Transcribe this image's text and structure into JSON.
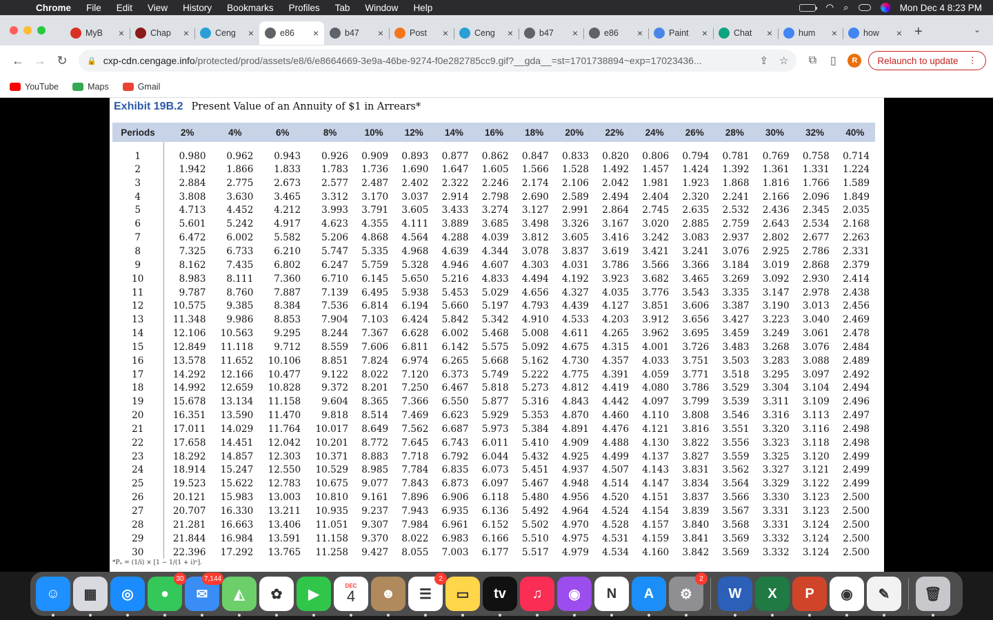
{
  "menubar": {
    "app": "Chrome",
    "items": [
      "File",
      "Edit",
      "View",
      "History",
      "Bookmarks",
      "Profiles",
      "Tab",
      "Window",
      "Help"
    ],
    "clock": "Mon Dec 4  8:23 PM"
  },
  "tabs": [
    {
      "label": "MyB",
      "icon": "bar-chart-icon",
      "color": "#d93025"
    },
    {
      "label": "Chap",
      "icon": "chapter-icon",
      "color": "#8b1a1a"
    },
    {
      "label": "Ceng",
      "icon": "cengage-icon",
      "color": "#2a9fd6"
    },
    {
      "label": "e86",
      "icon": "globe-icon",
      "color": "#5f6368"
    },
    {
      "label": "b47",
      "icon": "globe-icon",
      "color": "#5f6368"
    },
    {
      "label": "Post",
      "icon": "post-icon",
      "color": "#f5761a"
    },
    {
      "label": "Ceng",
      "icon": "cengage-icon",
      "color": "#2a9fd6"
    },
    {
      "label": "b47",
      "icon": "globe-icon",
      "color": "#5f6368"
    },
    {
      "label": "e86",
      "icon": "globe-icon",
      "color": "#5f6368"
    },
    {
      "label": "Paint",
      "icon": "paint-icon",
      "color": "#4a86e8"
    },
    {
      "label": "Chat",
      "icon": "chat-icon",
      "color": "#10a37f"
    },
    {
      "label": "hum",
      "icon": "google-icon",
      "color": "#4285f4"
    },
    {
      "label": "how",
      "icon": "google-icon",
      "color": "#4285f4"
    }
  ],
  "active_tab_index": 3,
  "address": {
    "host": "cxp-cdn.cengage.info",
    "path": "/protected/prod/assets/e8/6/e8664669-3e9a-46be-9274-f0e282785cc9.gif?__gda__=st=1701738894~exp=17023436..."
  },
  "profile_initial": "R",
  "relaunch_label": "Relaunch to update",
  "bookmarks": [
    {
      "label": "YouTube",
      "color": "#ff0000"
    },
    {
      "label": "Maps",
      "color": "#34a853"
    },
    {
      "label": "Gmail",
      "color": "#ea4335"
    }
  ],
  "exhibit": {
    "number": "Exhibit 19B.2",
    "title": "Present Value of an Annuity of $1 in Arrears*",
    "footnote": "*Pₙ = (1/i) × [1 − 1/(1 + i)ⁿ]."
  },
  "table": {
    "headers": [
      "Periods",
      "2%",
      "4%",
      "6%",
      "8%",
      "10%",
      "12%",
      "14%",
      "16%",
      "18%",
      "20%",
      "22%",
      "24%",
      "26%",
      "28%",
      "30%",
      "32%",
      "40%"
    ],
    "rows": [
      [
        "1",
        "0.980",
        "0.962",
        "0.943",
        "0.926",
        "0.909",
        "0.893",
        "0.877",
        "0.862",
        "0.847",
        "0.833",
        "0.820",
        "0.806",
        "0.794",
        "0.781",
        "0.769",
        "0.758",
        "0.714"
      ],
      [
        "2",
        "1.942",
        "1.866",
        "1.833",
        "1.783",
        "1.736",
        "1.690",
        "1.647",
        "1.605",
        "1.566",
        "1.528",
        "1.492",
        "1.457",
        "1.424",
        "1.392",
        "1.361",
        "1.331",
        "1.224"
      ],
      [
        "3",
        "2.884",
        "2.775",
        "2.673",
        "2.577",
        "2.487",
        "2.402",
        "2.322",
        "2.246",
        "2.174",
        "2.106",
        "2.042",
        "1.981",
        "1.923",
        "1.868",
        "1.816",
        "1.766",
        "1.589"
      ],
      [
        "4",
        "3.808",
        "3.630",
        "3.465",
        "3.312",
        "3.170",
        "3.037",
        "2.914",
        "2.798",
        "2.690",
        "2.589",
        "2.494",
        "2.404",
        "2.320",
        "2.241",
        "2.166",
        "2.096",
        "1.849"
      ],
      [
        "5",
        "4.713",
        "4.452",
        "4.212",
        "3.993",
        "3.791",
        "3.605",
        "3.433",
        "3.274",
        "3.127",
        "2.991",
        "2.864",
        "2.745",
        "2.635",
        "2.532",
        "2.436",
        "2.345",
        "2.035"
      ],
      [
        "6",
        "5.601",
        "5.242",
        "4.917",
        "4.623",
        "4.355",
        "4.111",
        "3.889",
        "3.685",
        "3.498",
        "3.326",
        "3.167",
        "3.020",
        "2.885",
        "2.759",
        "2.643",
        "2.534",
        "2.168"
      ],
      [
        "7",
        "6.472",
        "6.002",
        "5.582",
        "5.206",
        "4.868",
        "4.564",
        "4.288",
        "4.039",
        "3.812",
        "3.605",
        "3.416",
        "3.242",
        "3.083",
        "2.937",
        "2.802",
        "2.677",
        "2.263"
      ],
      [
        "8",
        "7.325",
        "6.733",
        "6.210",
        "5.747",
        "5.335",
        "4.968",
        "4.639",
        "4.344",
        "3.078",
        "3.837",
        "3.619",
        "3.421",
        "3.241",
        "3.076",
        "2.925",
        "2.786",
        "2.331"
      ],
      [
        "9",
        "8.162",
        "7.435",
        "6.802",
        "6.247",
        "5.759",
        "5.328",
        "4.946",
        "4.607",
        "4.303",
        "4.031",
        "3.786",
        "3.566",
        "3.366",
        "3.184",
        "3.019",
        "2.868",
        "2.379"
      ],
      [
        "10",
        "8.983",
        "8.111",
        "7.360",
        "6.710",
        "6.145",
        "5.650",
        "5.216",
        "4.833",
        "4.494",
        "4.192",
        "3.923",
        "3.682",
        "3.465",
        "3.269",
        "3.092",
        "2.930",
        "2.414"
      ],
      [
        "11",
        "9.787",
        "8.760",
        "7.887",
        "7.139",
        "6.495",
        "5.938",
        "5.453",
        "5.029",
        "4.656",
        "4.327",
        "4.035",
        "3.776",
        "3.543",
        "3.335",
        "3.147",
        "2.978",
        "2.438"
      ],
      [
        "12",
        "10.575",
        "9.385",
        "8.384",
        "7.536",
        "6.814",
        "6.194",
        "5.660",
        "5.197",
        "4.793",
        "4.439",
        "4.127",
        "3.851",
        "3.606",
        "3.387",
        "3.190",
        "3.013",
        "2.456"
      ],
      [
        "13",
        "11.348",
        "9.986",
        "8.853",
        "7.904",
        "7.103",
        "6.424",
        "5.842",
        "5.342",
        "4.910",
        "4.533",
        "4.203",
        "3.912",
        "3.656",
        "3.427",
        "3.223",
        "3.040",
        "2.469"
      ],
      [
        "14",
        "12.106",
        "10.563",
        "9.295",
        "8.244",
        "7.367",
        "6.628",
        "6.002",
        "5.468",
        "5.008",
        "4.611",
        "4.265",
        "3.962",
        "3.695",
        "3.459",
        "3.249",
        "3.061",
        "2.478"
      ],
      [
        "15",
        "12.849",
        "11.118",
        "9.712",
        "8.559",
        "7.606",
        "6.811",
        "6.142",
        "5.575",
        "5.092",
        "4.675",
        "4.315",
        "4.001",
        "3.726",
        "3.483",
        "3.268",
        "3.076",
        "2.484"
      ],
      [
        "16",
        "13.578",
        "11.652",
        "10.106",
        "8.851",
        "7.824",
        "6.974",
        "6.265",
        "5.668",
        "5.162",
        "4.730",
        "4.357",
        "4.033",
        "3.751",
        "3.503",
        "3.283",
        "3.088",
        "2.489"
      ],
      [
        "17",
        "14.292",
        "12.166",
        "10.477",
        "9.122",
        "8.022",
        "7.120",
        "6.373",
        "5.749",
        "5.222",
        "4.775",
        "4.391",
        "4.059",
        "3.771",
        "3.518",
        "3.295",
        "3.097",
        "2.492"
      ],
      [
        "18",
        "14.992",
        "12.659",
        "10.828",
        "9.372",
        "8.201",
        "7.250",
        "6.467",
        "5.818",
        "5.273",
        "4.812",
        "4.419",
        "4.080",
        "3.786",
        "3.529",
        "3.304",
        "3.104",
        "2.494"
      ],
      [
        "19",
        "15.678",
        "13.134",
        "11.158",
        "9.604",
        "8.365",
        "7.366",
        "6.550",
        "5.877",
        "5.316",
        "4.843",
        "4.442",
        "4.097",
        "3.799",
        "3.539",
        "3.311",
        "3.109",
        "2.496"
      ],
      [
        "20",
        "16.351",
        "13.590",
        "11.470",
        "9.818",
        "8.514",
        "7.469",
        "6.623",
        "5.929",
        "5.353",
        "4.870",
        "4.460",
        "4.110",
        "3.808",
        "3.546",
        "3.316",
        "3.113",
        "2.497"
      ],
      [
        "21",
        "17.011",
        "14.029",
        "11.764",
        "10.017",
        "8.649",
        "7.562",
        "6.687",
        "5.973",
        "5.384",
        "4.891",
        "4.476",
        "4.121",
        "3.816",
        "3.551",
        "3.320",
        "3.116",
        "2.498"
      ],
      [
        "22",
        "17.658",
        "14.451",
        "12.042",
        "10.201",
        "8.772",
        "7.645",
        "6.743",
        "6.011",
        "5.410",
        "4.909",
        "4.488",
        "4.130",
        "3.822",
        "3.556",
        "3.323",
        "3.118",
        "2.498"
      ],
      [
        "23",
        "18.292",
        "14.857",
        "12.303",
        "10.371",
        "8.883",
        "7.718",
        "6.792",
        "6.044",
        "5.432",
        "4.925",
        "4.499",
        "4.137",
        "3.827",
        "3.559",
        "3.325",
        "3.120",
        "2.499"
      ],
      [
        "24",
        "18.914",
        "15.247",
        "12.550",
        "10.529",
        "8.985",
        "7.784",
        "6.835",
        "6.073",
        "5.451",
        "4.937",
        "4.507",
        "4.143",
        "3.831",
        "3.562",
        "3.327",
        "3.121",
        "2.499"
      ],
      [
        "25",
        "19.523",
        "15.622",
        "12.783",
        "10.675",
        "9.077",
        "7.843",
        "6.873",
        "6.097",
        "5.467",
        "4.948",
        "4.514",
        "4.147",
        "3.834",
        "3.564",
        "3.329",
        "3.122",
        "2.499"
      ],
      [
        "26",
        "20.121",
        "15.983",
        "13.003",
        "10.810",
        "9.161",
        "7.896",
        "6.906",
        "6.118",
        "5.480",
        "4.956",
        "4.520",
        "4.151",
        "3.837",
        "3.566",
        "3.330",
        "3.123",
        "2.500"
      ],
      [
        "27",
        "20.707",
        "16.330",
        "13.211",
        "10.935",
        "9.237",
        "7.943",
        "6.935",
        "6.136",
        "5.492",
        "4.964",
        "4.524",
        "4.154",
        "3.839",
        "3.567",
        "3.331",
        "3.123",
        "2.500"
      ],
      [
        "28",
        "21.281",
        "16.663",
        "13.406",
        "11.051",
        "9.307",
        "7.984",
        "6.961",
        "6.152",
        "5.502",
        "4.970",
        "4.528",
        "4.157",
        "3.840",
        "3.568",
        "3.331",
        "3.124",
        "2.500"
      ],
      [
        "29",
        "21.844",
        "16.984",
        "13.591",
        "11.158",
        "9.370",
        "8.022",
        "6.983",
        "6.166",
        "5.510",
        "4.975",
        "4.531",
        "4.159",
        "3.841",
        "3.569",
        "3.332",
        "3.124",
        "2.500"
      ],
      [
        "30",
        "22.396",
        "17.292",
        "13.765",
        "11.258",
        "9.427",
        "8.055",
        "7.003",
        "6.177",
        "5.517",
        "4.979",
        "4.534",
        "4.160",
        "3.842",
        "3.569",
        "3.332",
        "3.124",
        "2.500"
      ]
    ]
  },
  "dock": [
    {
      "name": "finder-icon",
      "color": "#1e90ff",
      "glyph": "☺"
    },
    {
      "name": "launchpad-icon",
      "color": "#d9d9e0",
      "glyph": "▦"
    },
    {
      "name": "safari-icon",
      "color": "#1a8cff",
      "glyph": "◎"
    },
    {
      "name": "messages-icon",
      "color": "#34c759",
      "glyph": "●",
      "badge": "30"
    },
    {
      "name": "mail-icon",
      "color": "#3a8df5",
      "glyph": "✉",
      "badge": "7,144"
    },
    {
      "name": "maps-icon",
      "color": "#6ccf6a",
      "glyph": "◭"
    },
    {
      "name": "photos-icon",
      "color": "#ffffff",
      "glyph": "✿"
    },
    {
      "name": "facetime-icon",
      "color": "#30c64a",
      "glyph": "▶"
    },
    {
      "name": "calendar-icon",
      "color": "#ffffff",
      "glyph": "4",
      "caption": "DEC"
    },
    {
      "name": "contacts-icon",
      "color": "#b08a5c",
      "glyph": "☻"
    },
    {
      "name": "reminders-icon",
      "color": "#ffffff",
      "glyph": "☰",
      "badge": "2"
    },
    {
      "name": "notes-icon",
      "color": "#ffd54a",
      "glyph": "▭"
    },
    {
      "name": "apple-tv-icon",
      "color": "#111111",
      "glyph": "tv"
    },
    {
      "name": "music-icon",
      "color": "#fa2d55",
      "glyph": "♫"
    },
    {
      "name": "podcasts-icon",
      "color": "#9b4dee",
      "glyph": "◉"
    },
    {
      "name": "news-icon",
      "color": "#ffffff",
      "glyph": "N"
    },
    {
      "name": "app-store-icon",
      "color": "#1c8ef9",
      "glyph": "A"
    },
    {
      "name": "system-settings-icon",
      "color": "#8e8e93",
      "glyph": "⚙",
      "badge": "2"
    },
    {
      "sep": true
    },
    {
      "name": "word-icon",
      "color": "#2b5fb8",
      "glyph": "W"
    },
    {
      "name": "excel-icon",
      "color": "#1f7a44",
      "glyph": "X"
    },
    {
      "name": "powerpoint-icon",
      "color": "#d0442a",
      "glyph": "P"
    },
    {
      "name": "chrome-icon",
      "color": "#ffffff",
      "glyph": "◉"
    },
    {
      "name": "textedit-icon",
      "color": "#f2f2f2",
      "glyph": "✎"
    },
    {
      "sep": true
    },
    {
      "name": "trash-icon",
      "color": "#c8c8cc",
      "glyph": "🗑"
    }
  ]
}
